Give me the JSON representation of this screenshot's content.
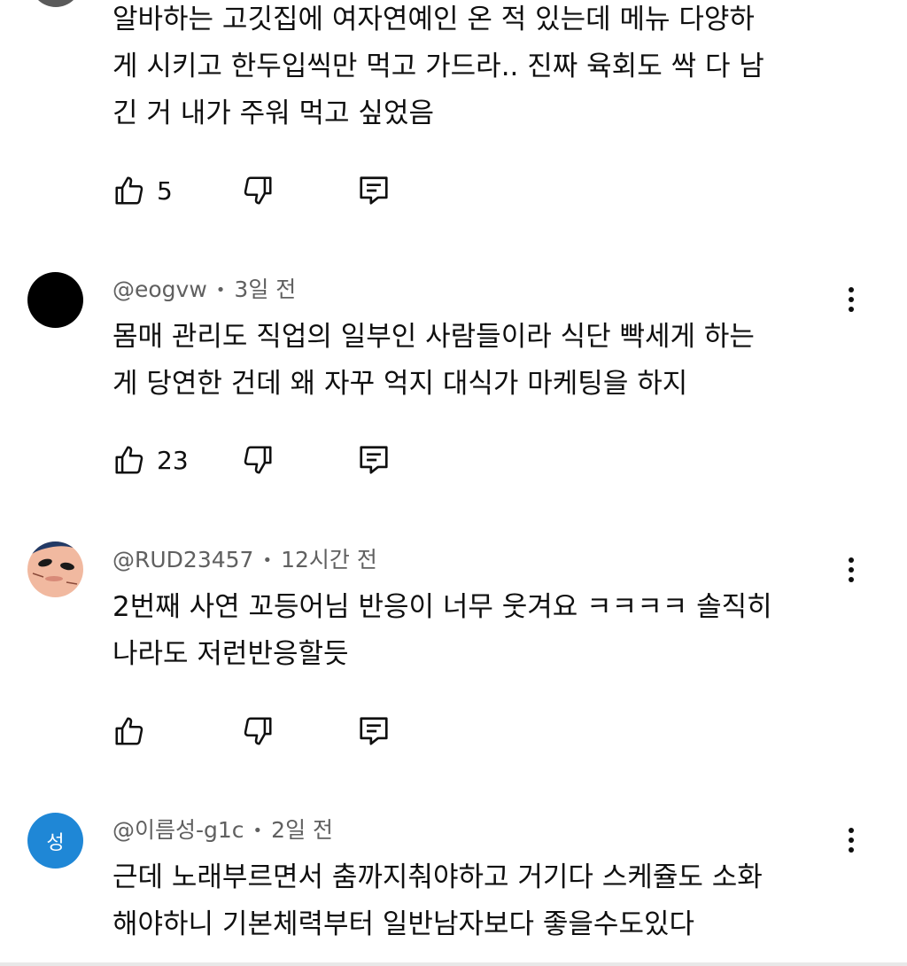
{
  "comments": [
    {
      "author": "",
      "time": "",
      "lines": [
        "알바하는 고깃집에 여자연예인 온 적 있는데 메뉴 다양하",
        "게 시키고 한두입씩만 먹고 가드라.. 진짜 육회도 싹 다 남",
        "긴 거 내가 주워 먹고 싶었음"
      ],
      "likes": "5"
    },
    {
      "author": "@eogvw",
      "time": "3일 전",
      "lines": [
        "몸매 관리도 직업의 일부인 사람들이라 식단 빡세게 하는",
        "게 당연한 건데 왜 자꾸 억지 대식가 마케팅을 하지"
      ],
      "likes": "23"
    },
    {
      "author": "@RUD23457",
      "time": "12시간 전",
      "lines": [
        "2번째 사연 꼬등어님 반응이 너무 웃겨요 ㅋㅋㅋㅋ 솔직히",
        "나라도 저런반응할듯"
      ],
      "likes": ""
    },
    {
      "author": "@이름성-g1c",
      "time": "2일 전",
      "avatar_letter": "성",
      "lines": [
        "근데 노래부르면서 춤까지춰야하고 거기다 스케쥴도 소화",
        "해야하니 기본체력부터 일반남자보다 좋을수도있다"
      ]
    }
  ],
  "colors": {
    "meta": "#606060",
    "avatar_blue": "#1f87d6"
  },
  "icons": [
    "thumbs-up-icon",
    "thumbs-down-icon",
    "reply-icon",
    "more-vert-icon"
  ]
}
